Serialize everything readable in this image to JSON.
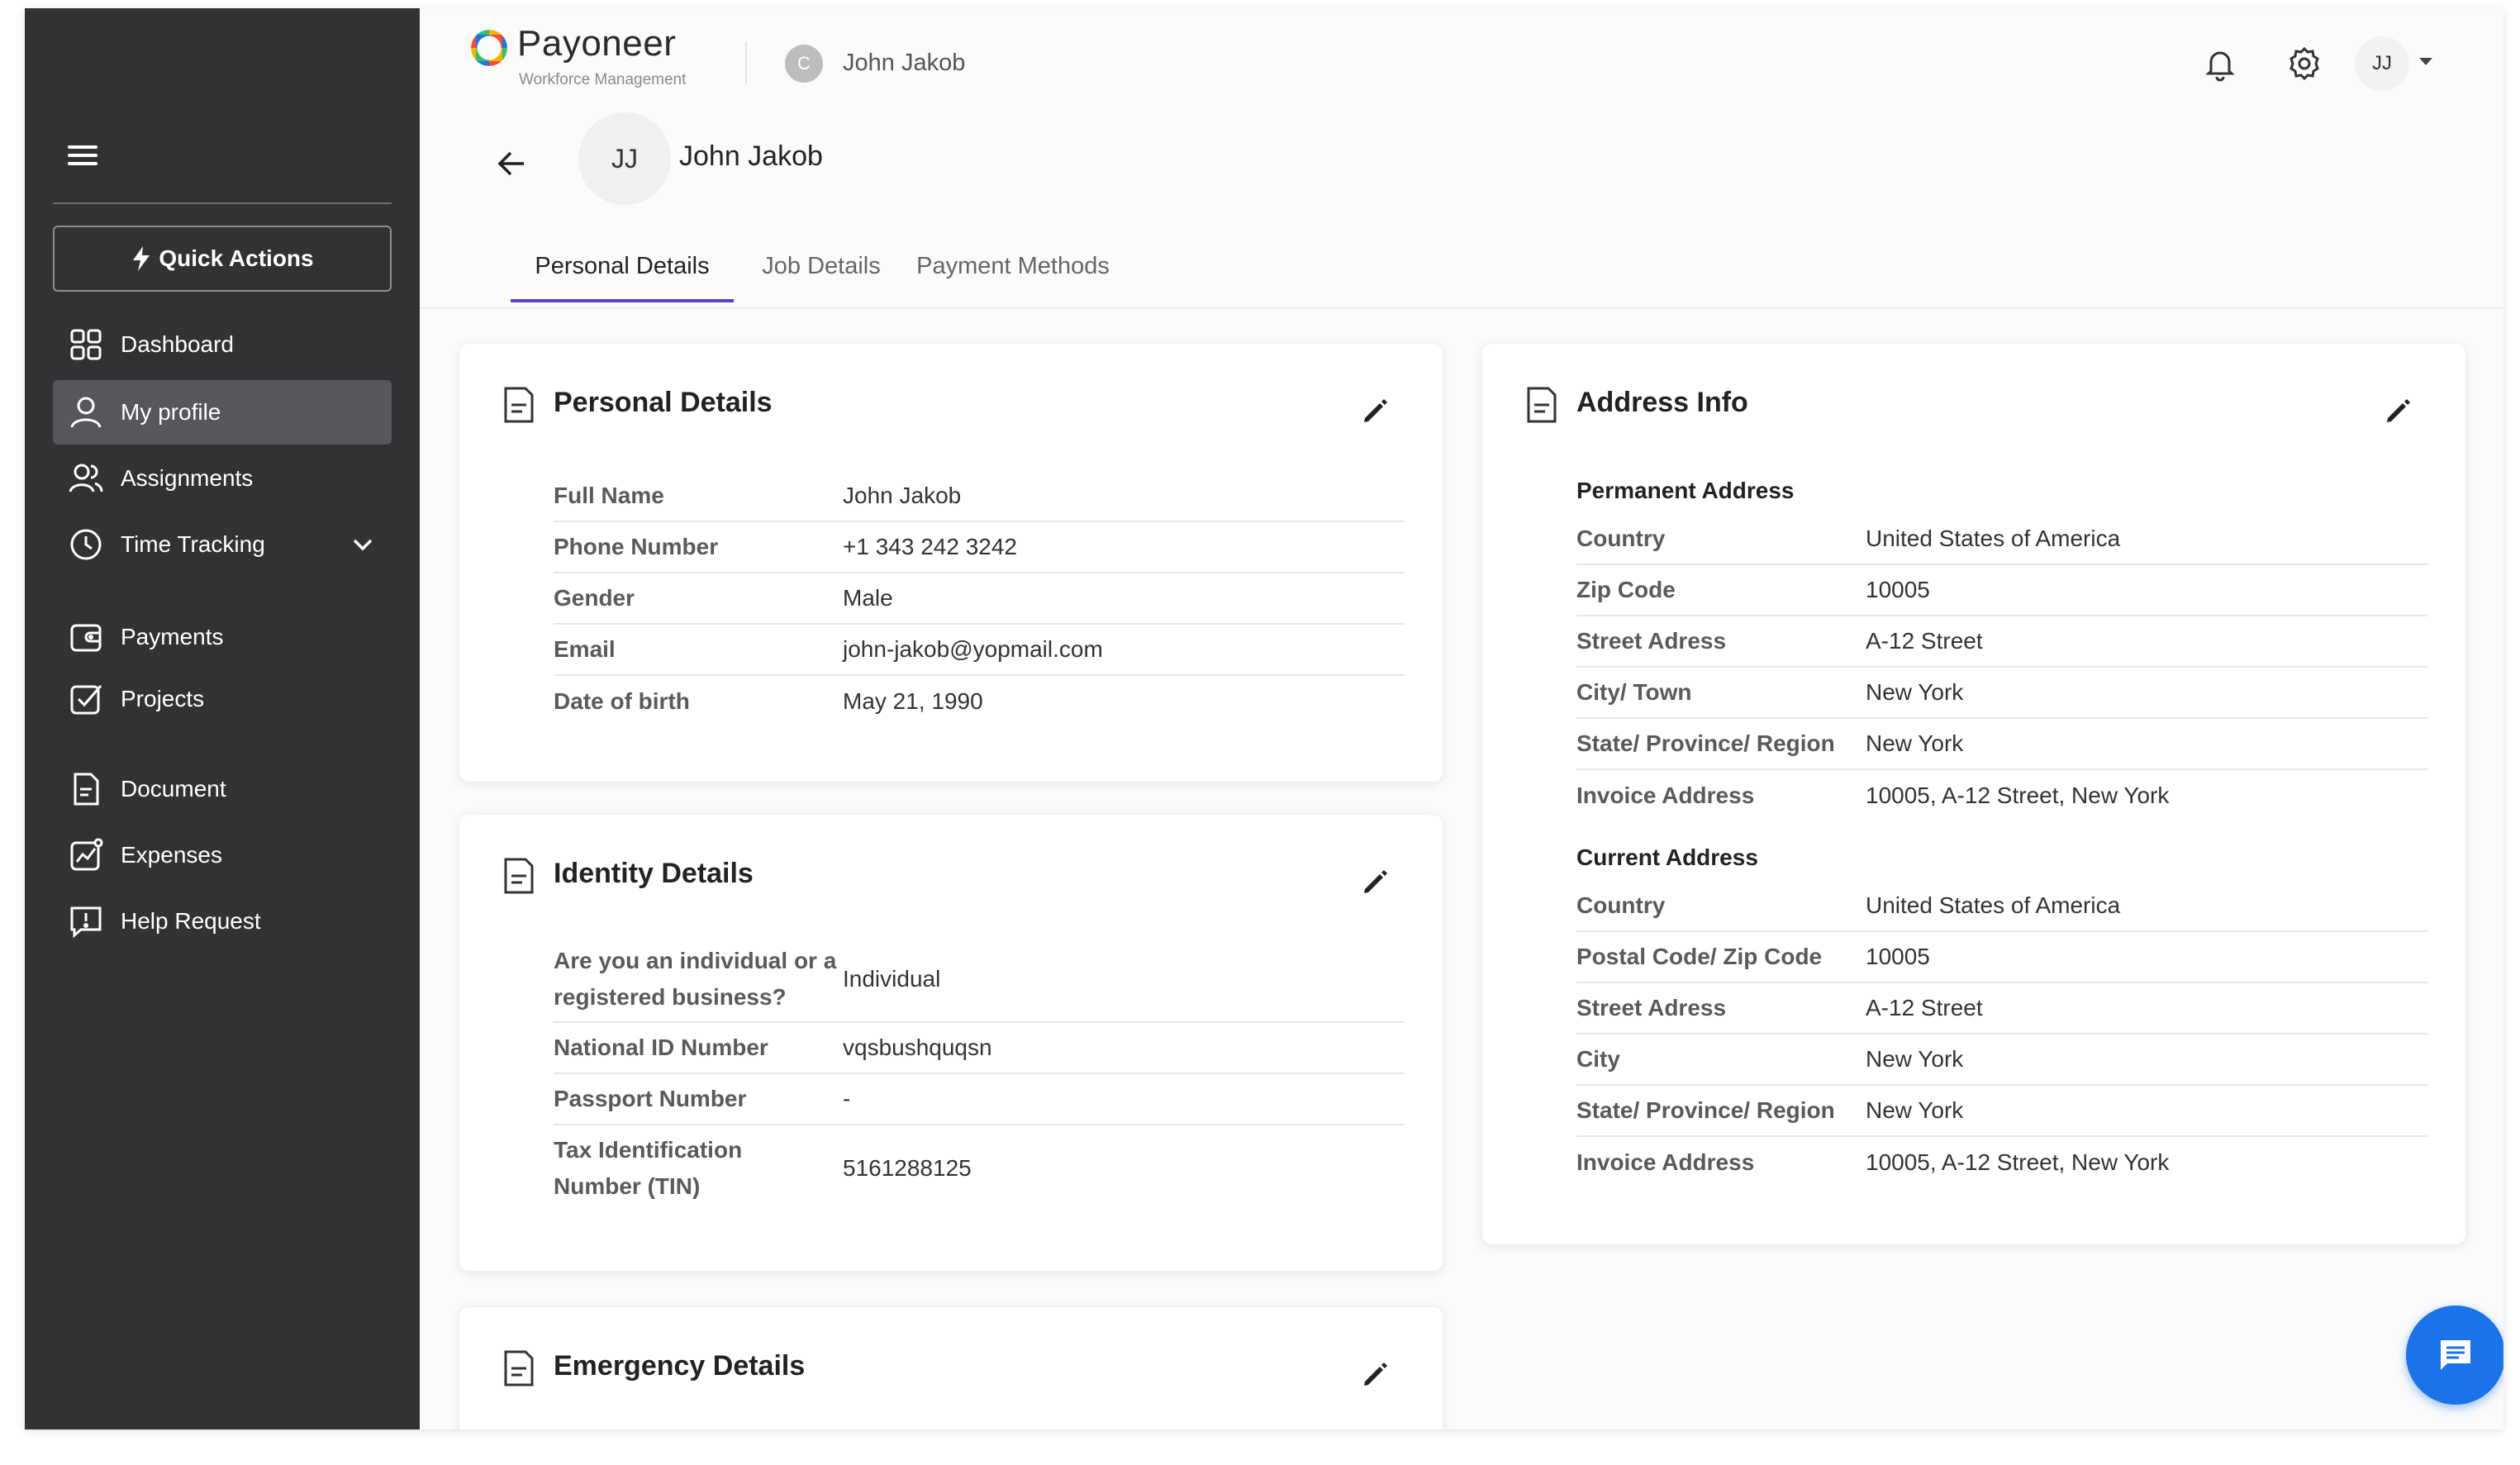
{
  "sidebar": {
    "quick_actions": "Quick Actions",
    "items": [
      {
        "label": "Dashboard",
        "icon": "grid-icon"
      },
      {
        "label": "My profile",
        "icon": "person-icon",
        "active": true
      },
      {
        "label": "Assignments",
        "icon": "people-icon"
      },
      {
        "label": "Time Tracking",
        "icon": "clock-icon",
        "expandable": true
      },
      {
        "label": "Payments",
        "icon": "wallet-icon"
      },
      {
        "label": "Projects",
        "icon": "checkbox-icon"
      },
      {
        "label": "Document",
        "icon": "document-icon"
      },
      {
        "label": "Expenses",
        "icon": "chart-icon"
      },
      {
        "label": "Help Request",
        "icon": "help-message-icon"
      }
    ]
  },
  "header": {
    "brand": "Payoneer",
    "brand_sub": "Workforce Management",
    "org_initial": "C",
    "org_name": "John Jakob",
    "user_initials": "JJ"
  },
  "profile": {
    "initials": "JJ",
    "name": "John Jakob"
  },
  "tabs": [
    {
      "label": "Personal Details",
      "active": true
    },
    {
      "label": "Job Details"
    },
    {
      "label": "Payment Methods"
    }
  ],
  "personal_details": {
    "title": "Personal Details",
    "rows": [
      {
        "label": "Full Name",
        "value": "John Jakob"
      },
      {
        "label": "Phone Number",
        "value": "+1 343 242 3242"
      },
      {
        "label": "Gender",
        "value": "Male"
      },
      {
        "label": "Email",
        "value": "john-jakob@yopmail.com"
      },
      {
        "label": "Date of birth",
        "value": "May 21, 1990"
      }
    ]
  },
  "identity_details": {
    "title": "Identity Details",
    "rows": [
      {
        "label_line1": "Are you an individual or a",
        "label_line2": "registered business?",
        "value": "Individual"
      },
      {
        "label": "National ID Number",
        "value": "vqsbushquqsn"
      },
      {
        "label": "Passport Number",
        "value": "-"
      },
      {
        "label_line1": "Tax Identification",
        "label_line2": "Number (TIN)",
        "value": "5161288125"
      }
    ]
  },
  "emergency_details": {
    "title": "Emergency Details"
  },
  "address_info": {
    "title": "Address Info",
    "permanent_label": "Permanent Address",
    "permanent": [
      {
        "label": "Country",
        "value": "United States of America"
      },
      {
        "label": "Zip Code",
        "value": "10005"
      },
      {
        "label": "Street Adress",
        "value": "A-12 Street"
      },
      {
        "label": "City/ Town",
        "value": "New York"
      },
      {
        "label": "State/ Province/ Region",
        "value": "New York"
      },
      {
        "label": "Invoice Address",
        "value": "10005, A-12 Street, New York"
      }
    ],
    "current_label": "Current Address",
    "current": [
      {
        "label": "Country",
        "value": "United States of America"
      },
      {
        "label": "Postal Code/ Zip Code",
        "value": "10005"
      },
      {
        "label": "Street Adress",
        "value": "A-12 Street"
      },
      {
        "label": "City",
        "value": "New York"
      },
      {
        "label": "State/ Province/ Region",
        "value": "New York"
      },
      {
        "label": "Invoice Address",
        "value": "10005, A-12 Street, New York"
      }
    ]
  },
  "colors": {
    "sidebar_bg": "#323234",
    "sidebar_active": "#57575b",
    "tab_indicator": "#5b3fc4",
    "chat_button": "#1a73e8"
  }
}
